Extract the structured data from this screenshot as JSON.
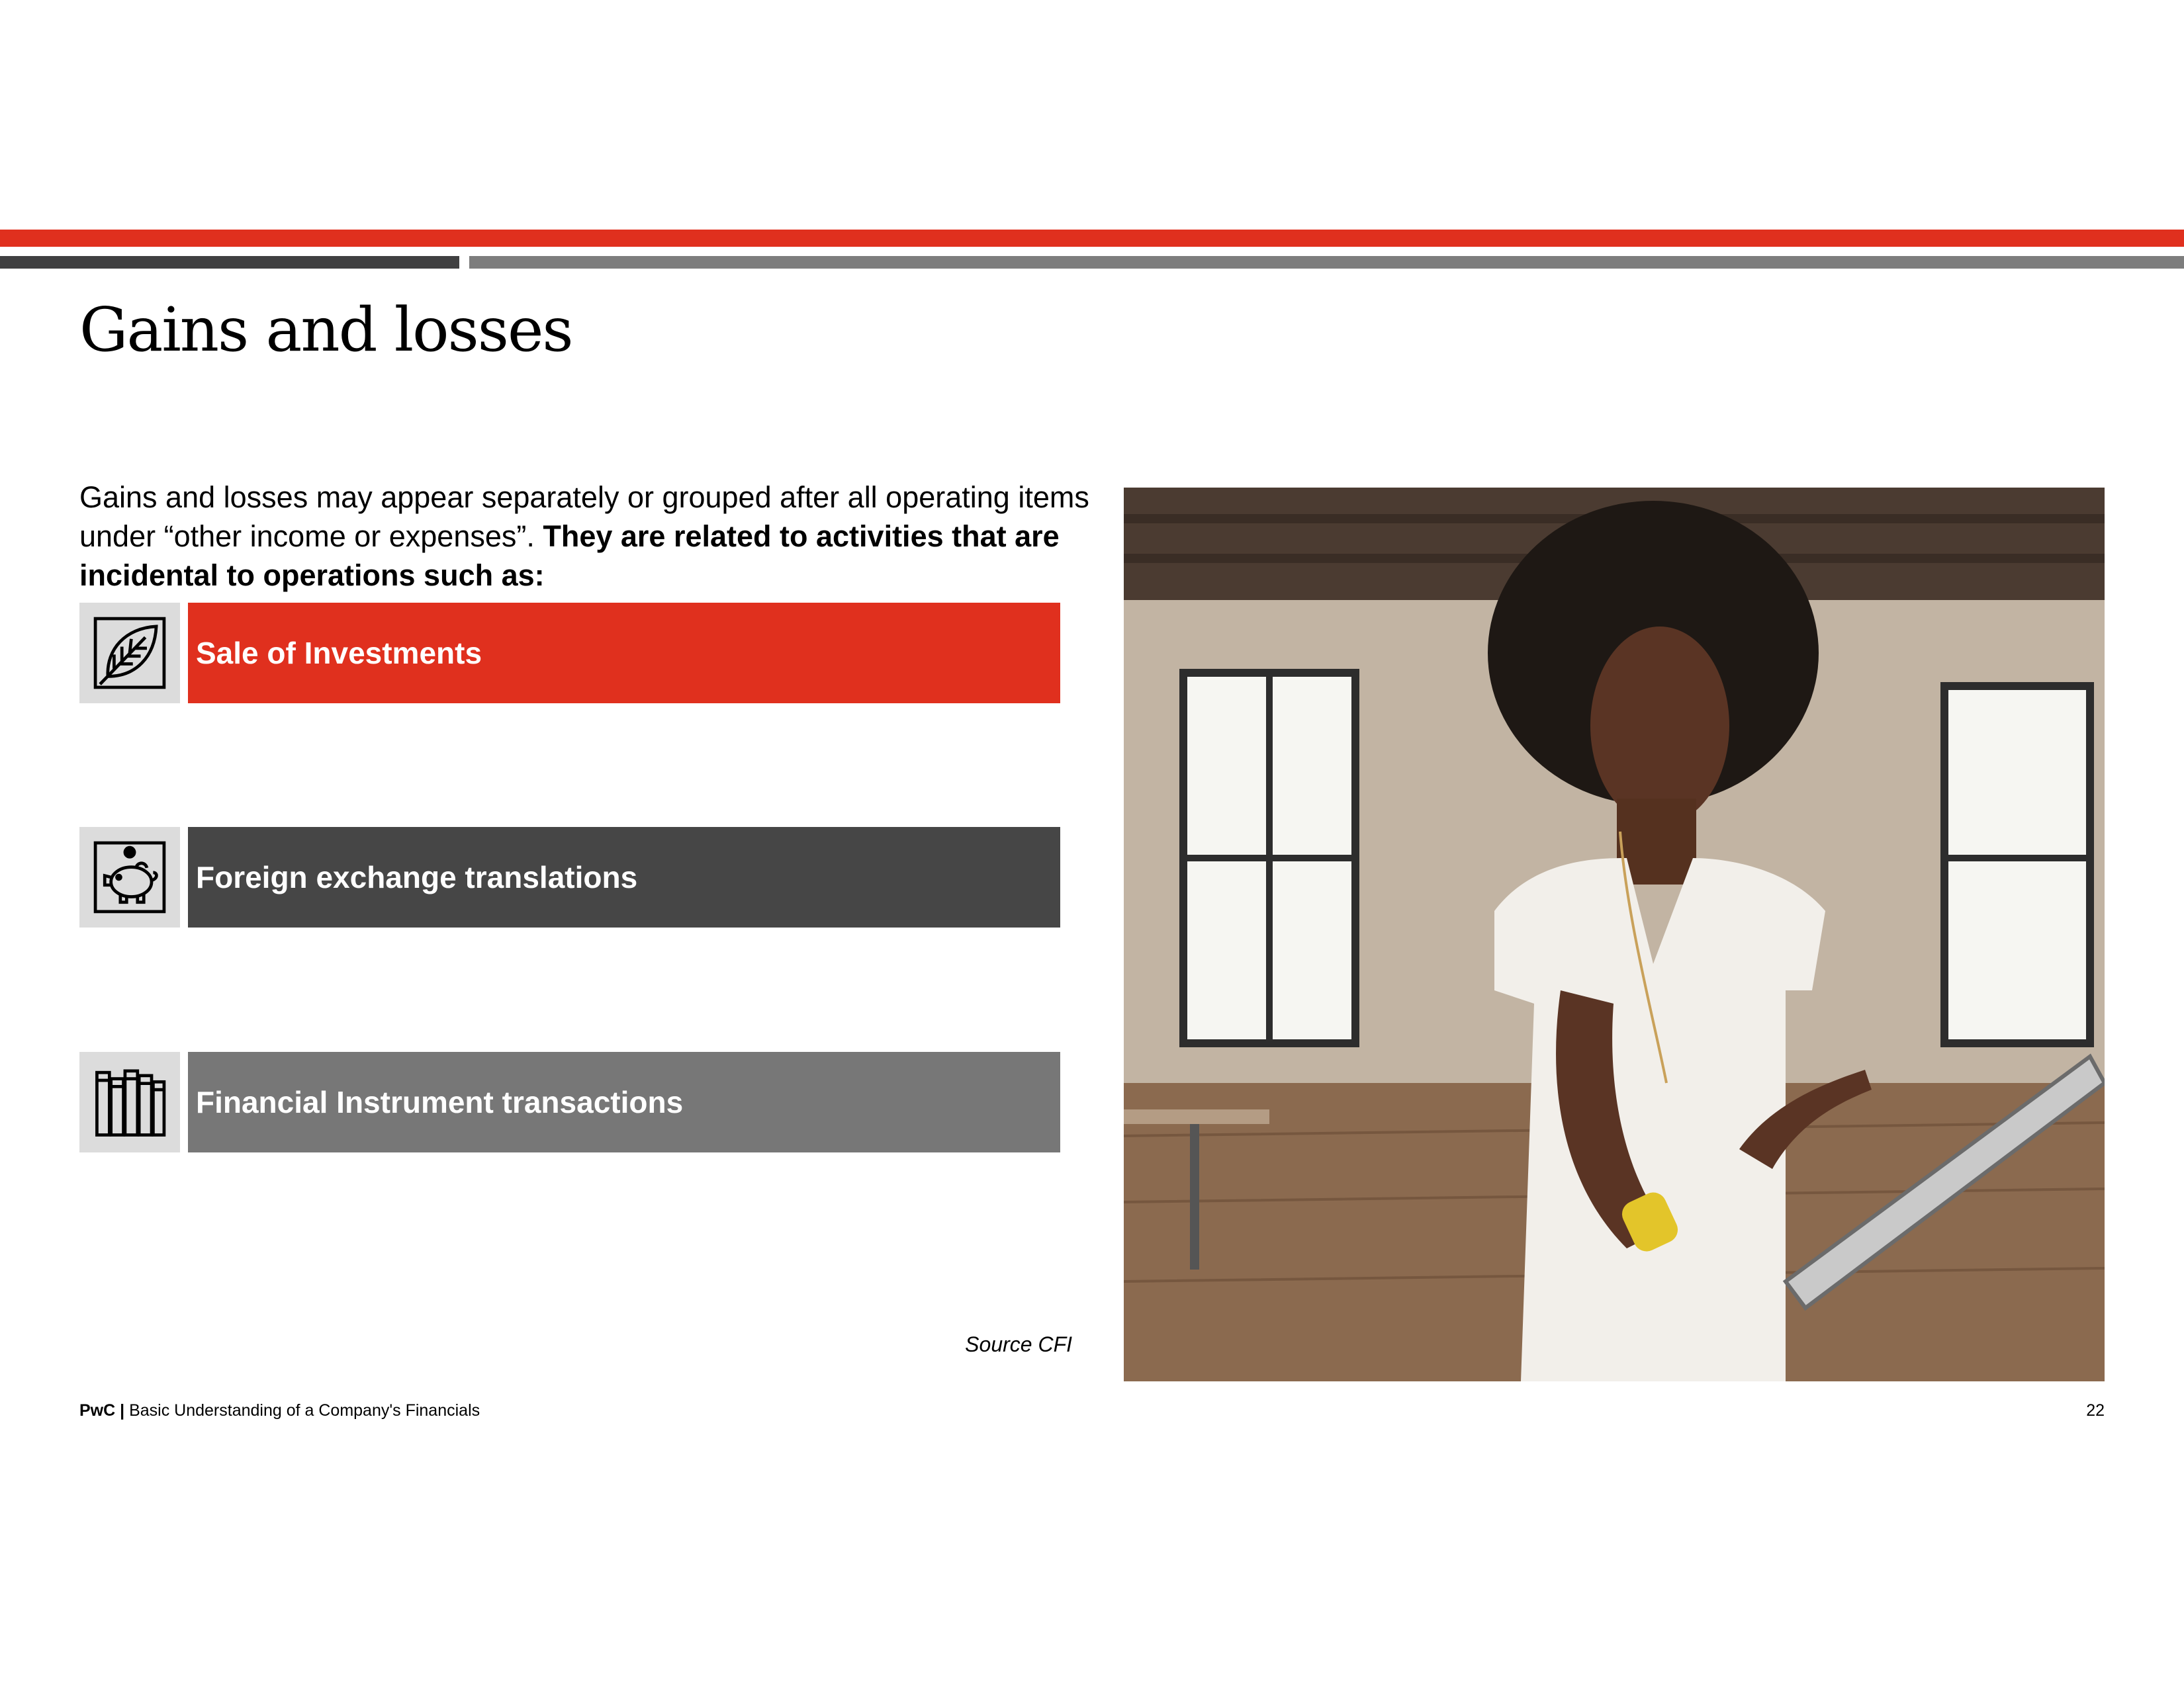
{
  "slide": {
    "title": "Gains and losses",
    "intro": {
      "normal": "Gains and losses may appear separately or grouped after all operating items under “other income or expenses”. ",
      "bold": "They are related to activities that are incidental to operations such as:"
    },
    "items": [
      {
        "label": "Sale of Investments",
        "icon": "leaf-icon",
        "color": "#e0301e"
      },
      {
        "label": "Foreign exchange translations",
        "icon": "piggy-bank-icon",
        "color": "#464646"
      },
      {
        "label": "Financial Instrument transactions",
        "icon": "books-icon",
        "color": "#777777"
      }
    ],
    "source": "Source CFI",
    "image": {
      "subject": "woman-with-tablet-photo"
    }
  },
  "footer": {
    "brand": "PwC",
    "separator": " | ",
    "text": "Basic Understanding of a Company's Financials",
    "page": "22"
  },
  "colors": {
    "accent": "#e0301e",
    "dark": "#404041",
    "grey": "#7d7d7d"
  }
}
